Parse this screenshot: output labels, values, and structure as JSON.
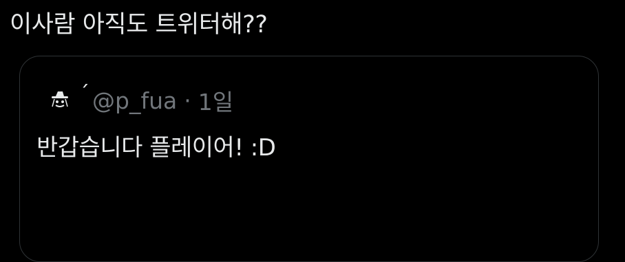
{
  "tweet": {
    "text": "이사람 아직도 트위터해??"
  },
  "quoted_tweet": {
    "avatar_icon": "hat-avatar-icon",
    "display_name": "ˊ",
    "handle": "@p_fua",
    "separator": "·",
    "time": "1일",
    "text": "반갑습니다 플레이어! :D"
  },
  "colors": {
    "background": "#000000",
    "text_primary": "#e7e9ea",
    "text_secondary": "#71767b",
    "border": "#2f3336"
  }
}
